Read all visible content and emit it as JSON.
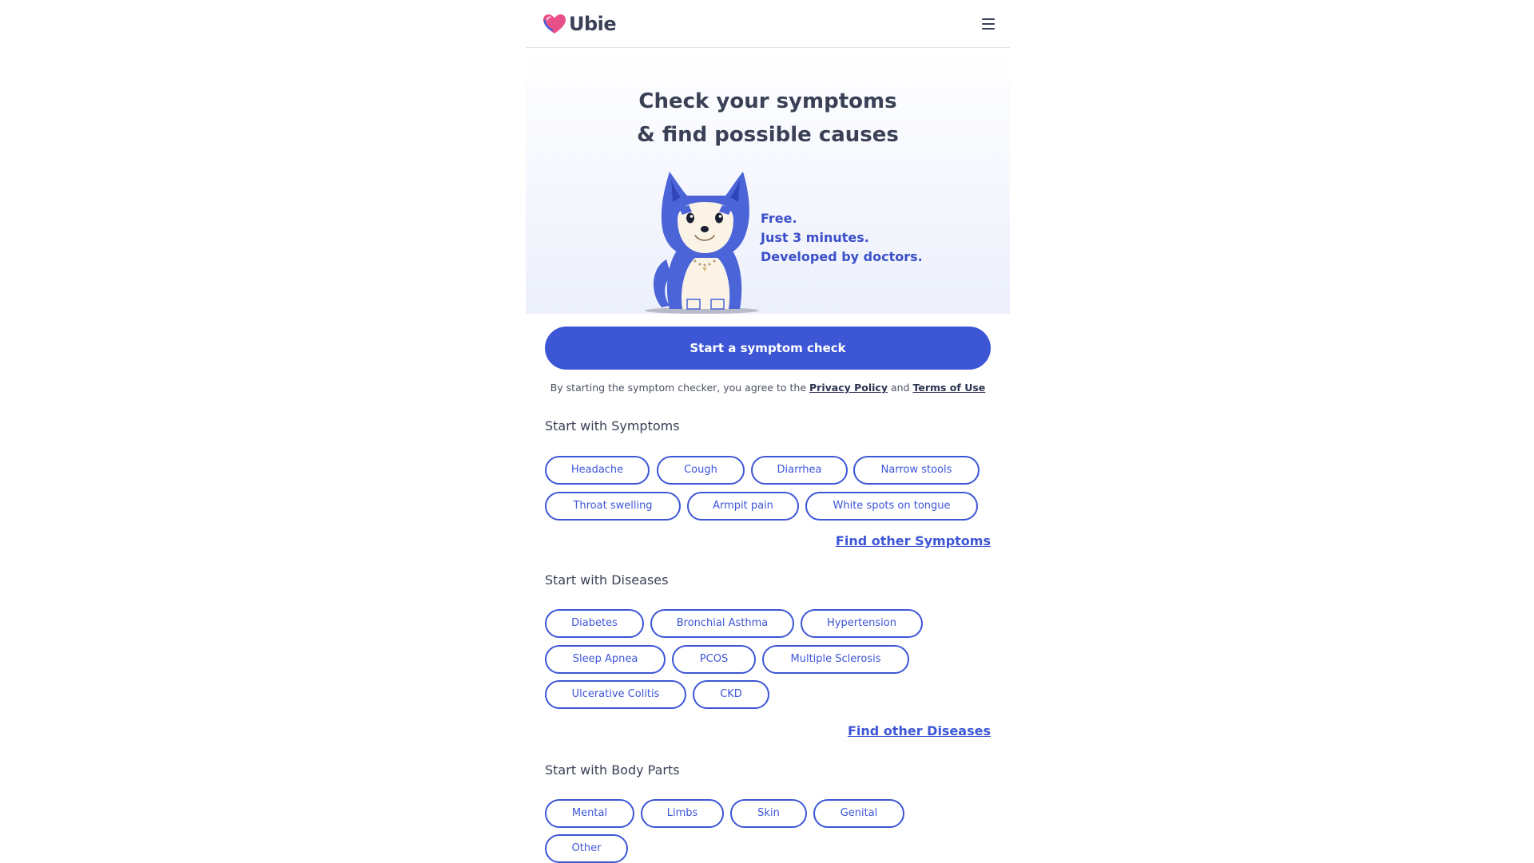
{
  "header": {
    "logo_text": "Ubie",
    "logo_icon": "heart-icon",
    "menu_icon": "hamburger-menu-icon"
  },
  "hero": {
    "title_line1": "Check your symptoms",
    "title_line2": "& find possible causes",
    "tagline": [
      "Free.",
      "Just 3 minutes.",
      "Developed by doctors."
    ]
  },
  "cta": {
    "label": "Start a symptom check"
  },
  "agreement": {
    "prefix": "By starting the symptom checker, you agree to the",
    "privacy_link": "Privacy Policy",
    "joiner": "and",
    "terms_link": "Terms of Use"
  },
  "symptoms": {
    "title": "Start with Symptoms",
    "chips": [
      "Headache",
      "Cough",
      "Diarrhea",
      "Narrow stools",
      "Throat swelling",
      "Armpit pain",
      "White spots on tongue"
    ],
    "more_link": "Find other Symptoms"
  },
  "diseases": {
    "title": "Start with Diseases",
    "chips": [
      "Diabetes",
      "Bronchial Asthma",
      "Hypertension",
      "Sleep Apnea",
      "PCOS",
      "Multiple Sclerosis",
      "Ulcerative Colitis",
      "CKD"
    ],
    "more_link": "Find other Diseases"
  },
  "body_parts": {
    "title": "Start with Body Parts",
    "chips": [
      "Mental",
      "Limbs",
      "Skin",
      "Genital",
      "Other"
    ]
  },
  "colors": {
    "primary": "#3d56d6",
    "heading": "#3a4156",
    "logo_heart": "#e8508a"
  }
}
